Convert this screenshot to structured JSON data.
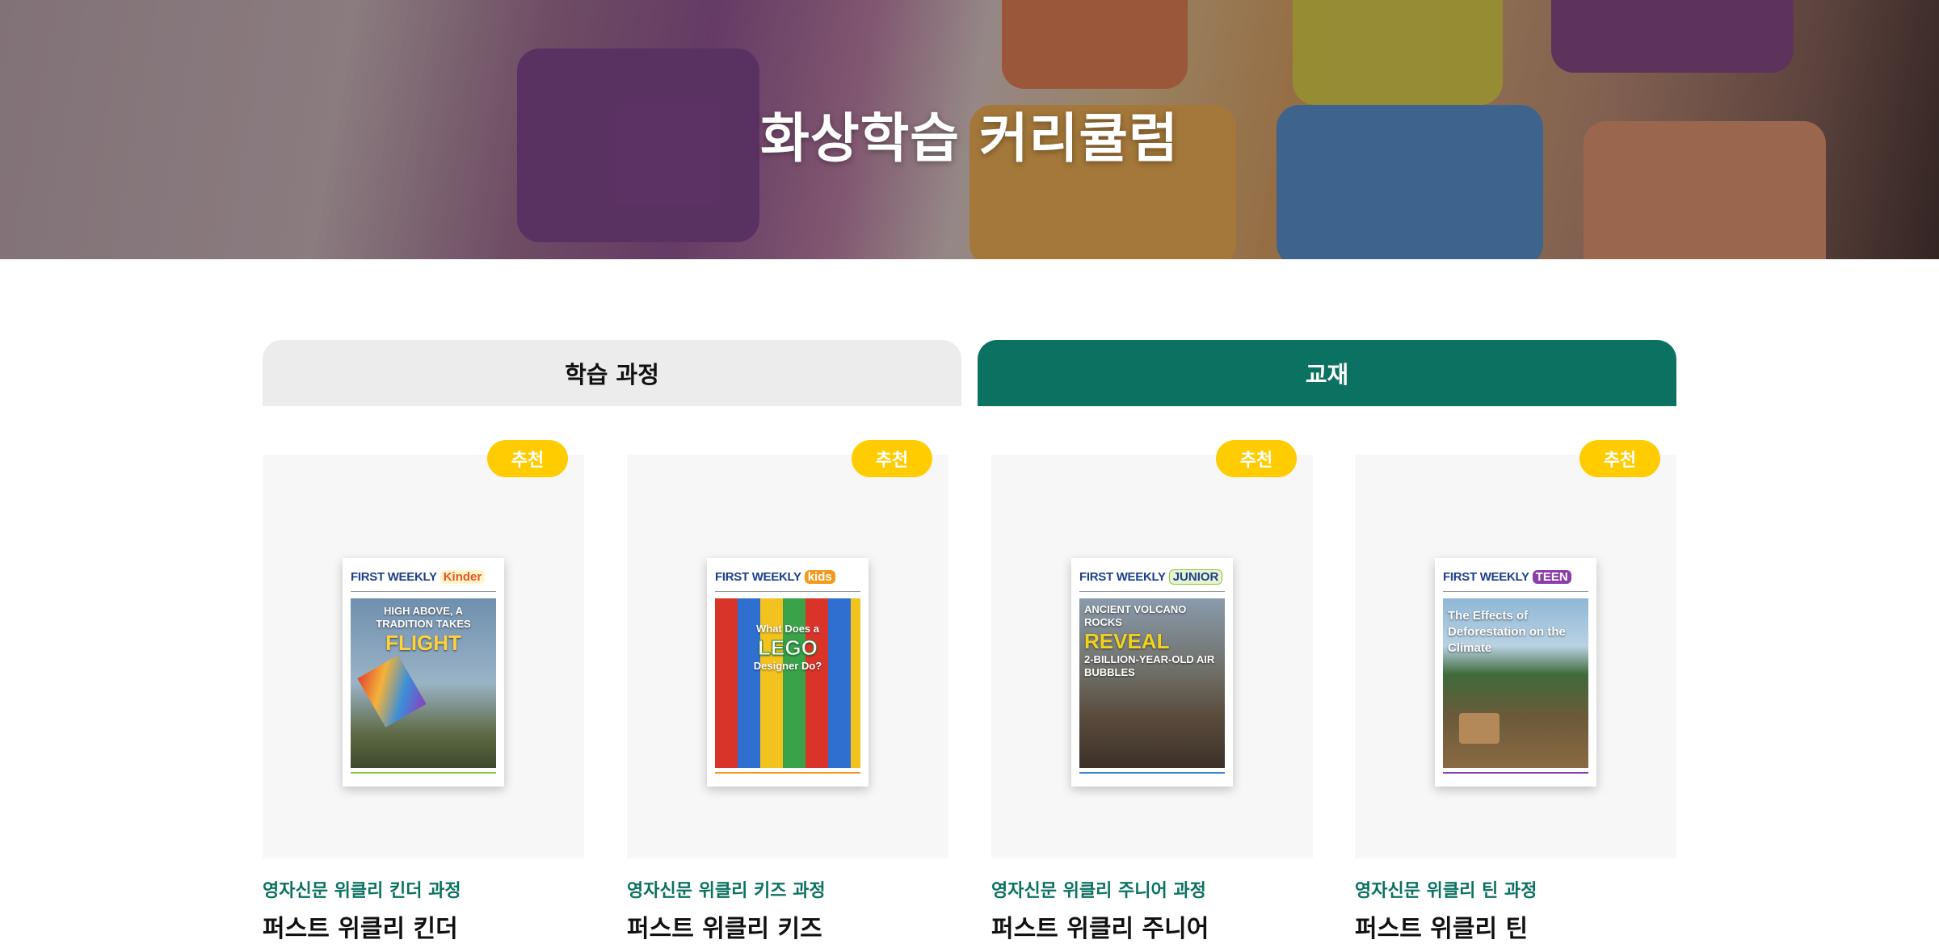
{
  "hero": {
    "title": "화상학습 커리큘럼"
  },
  "tabs": [
    {
      "label": "학습 과정",
      "active": false
    },
    {
      "label": "교재",
      "active": true
    }
  ],
  "colors": {
    "accent": "#0b7261",
    "badge": "#ffcc00",
    "tab_inactive": "#ececec",
    "card_bg": "#f7f7f7"
  },
  "products": [
    {
      "badge": "추천",
      "subtitle": "영자신문 위클리 킨더 과정",
      "title": "퍼스트 위클리 킨더",
      "cover": {
        "masthead": "FIRST WEEKLY",
        "edition": "Kinder",
        "headline": "HIGH ABOVE, A TRADITION TAKES",
        "headline_big": "FLIGHT"
      }
    },
    {
      "badge": "추천",
      "subtitle": "영자신문 위클리 키즈 과정",
      "title": "퍼스트 위클리 키즈",
      "cover": {
        "masthead": "FIRST WEEKLY",
        "edition": "kids",
        "headline": "What Does a",
        "headline_big": "LEGO",
        "headline_tail": "Designer Do?"
      }
    },
    {
      "badge": "추천",
      "subtitle": "영자신문 위클리 주니어 과정",
      "title": "퍼스트 위클리 주니어",
      "cover": {
        "masthead": "FIRST WEEKLY",
        "edition": "JUNIOR",
        "headline": "ANCIENT VOLCANO ROCKS",
        "headline_big": "REVEAL",
        "headline_tail": "2-BILLION-YEAR-OLD AIR BUBBLES"
      }
    },
    {
      "badge": "추천",
      "subtitle": "영자신문 위클리 틴 과정",
      "title": "퍼스트 위클리 틴",
      "cover": {
        "masthead": "FIRST WEEKLY",
        "edition": "TEEN",
        "headline": "The Effects of Deforestation on the Climate",
        "headline_big": ""
      }
    }
  ]
}
